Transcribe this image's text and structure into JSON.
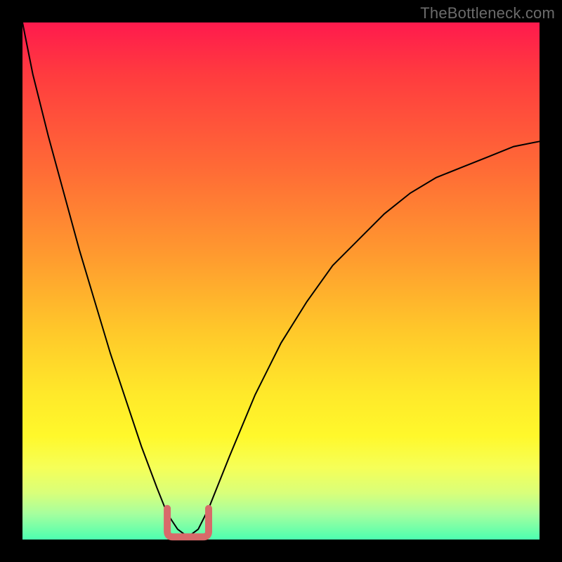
{
  "watermark": "TheBottleneck.com",
  "colors": {
    "frame": "#000000",
    "curve": "#000000",
    "marker": "#d86a6a",
    "grad_top": "#ff1a4d",
    "grad_bottom": "#4cffb0"
  },
  "chart_data": {
    "type": "line",
    "title": "",
    "xlabel": "",
    "ylabel": "",
    "xlim": [
      0,
      100
    ],
    "ylim": [
      0,
      100
    ],
    "grid": false,
    "series": [
      {
        "name": "bottleneck-curve",
        "x": [
          0,
          2,
          5,
          8,
          11,
          14,
          17,
          20,
          23,
          26,
          28,
          30,
          32,
          34,
          36,
          40,
          45,
          50,
          55,
          60,
          65,
          70,
          75,
          80,
          85,
          90,
          95,
          100
        ],
        "y": [
          100,
          90,
          78,
          67,
          56,
          46,
          36,
          27,
          18,
          10,
          5,
          2,
          0.5,
          2,
          6,
          16,
          28,
          38,
          46,
          53,
          58,
          63,
          67,
          70,
          72,
          74,
          76,
          77
        ]
      }
    ],
    "annotations": [
      {
        "name": "min-marker",
        "shape": "u",
        "x_center": 32,
        "x_half_width": 4,
        "y_bottom": 0.5,
        "y_top": 6,
        "color": "#d86a6a"
      }
    ]
  }
}
